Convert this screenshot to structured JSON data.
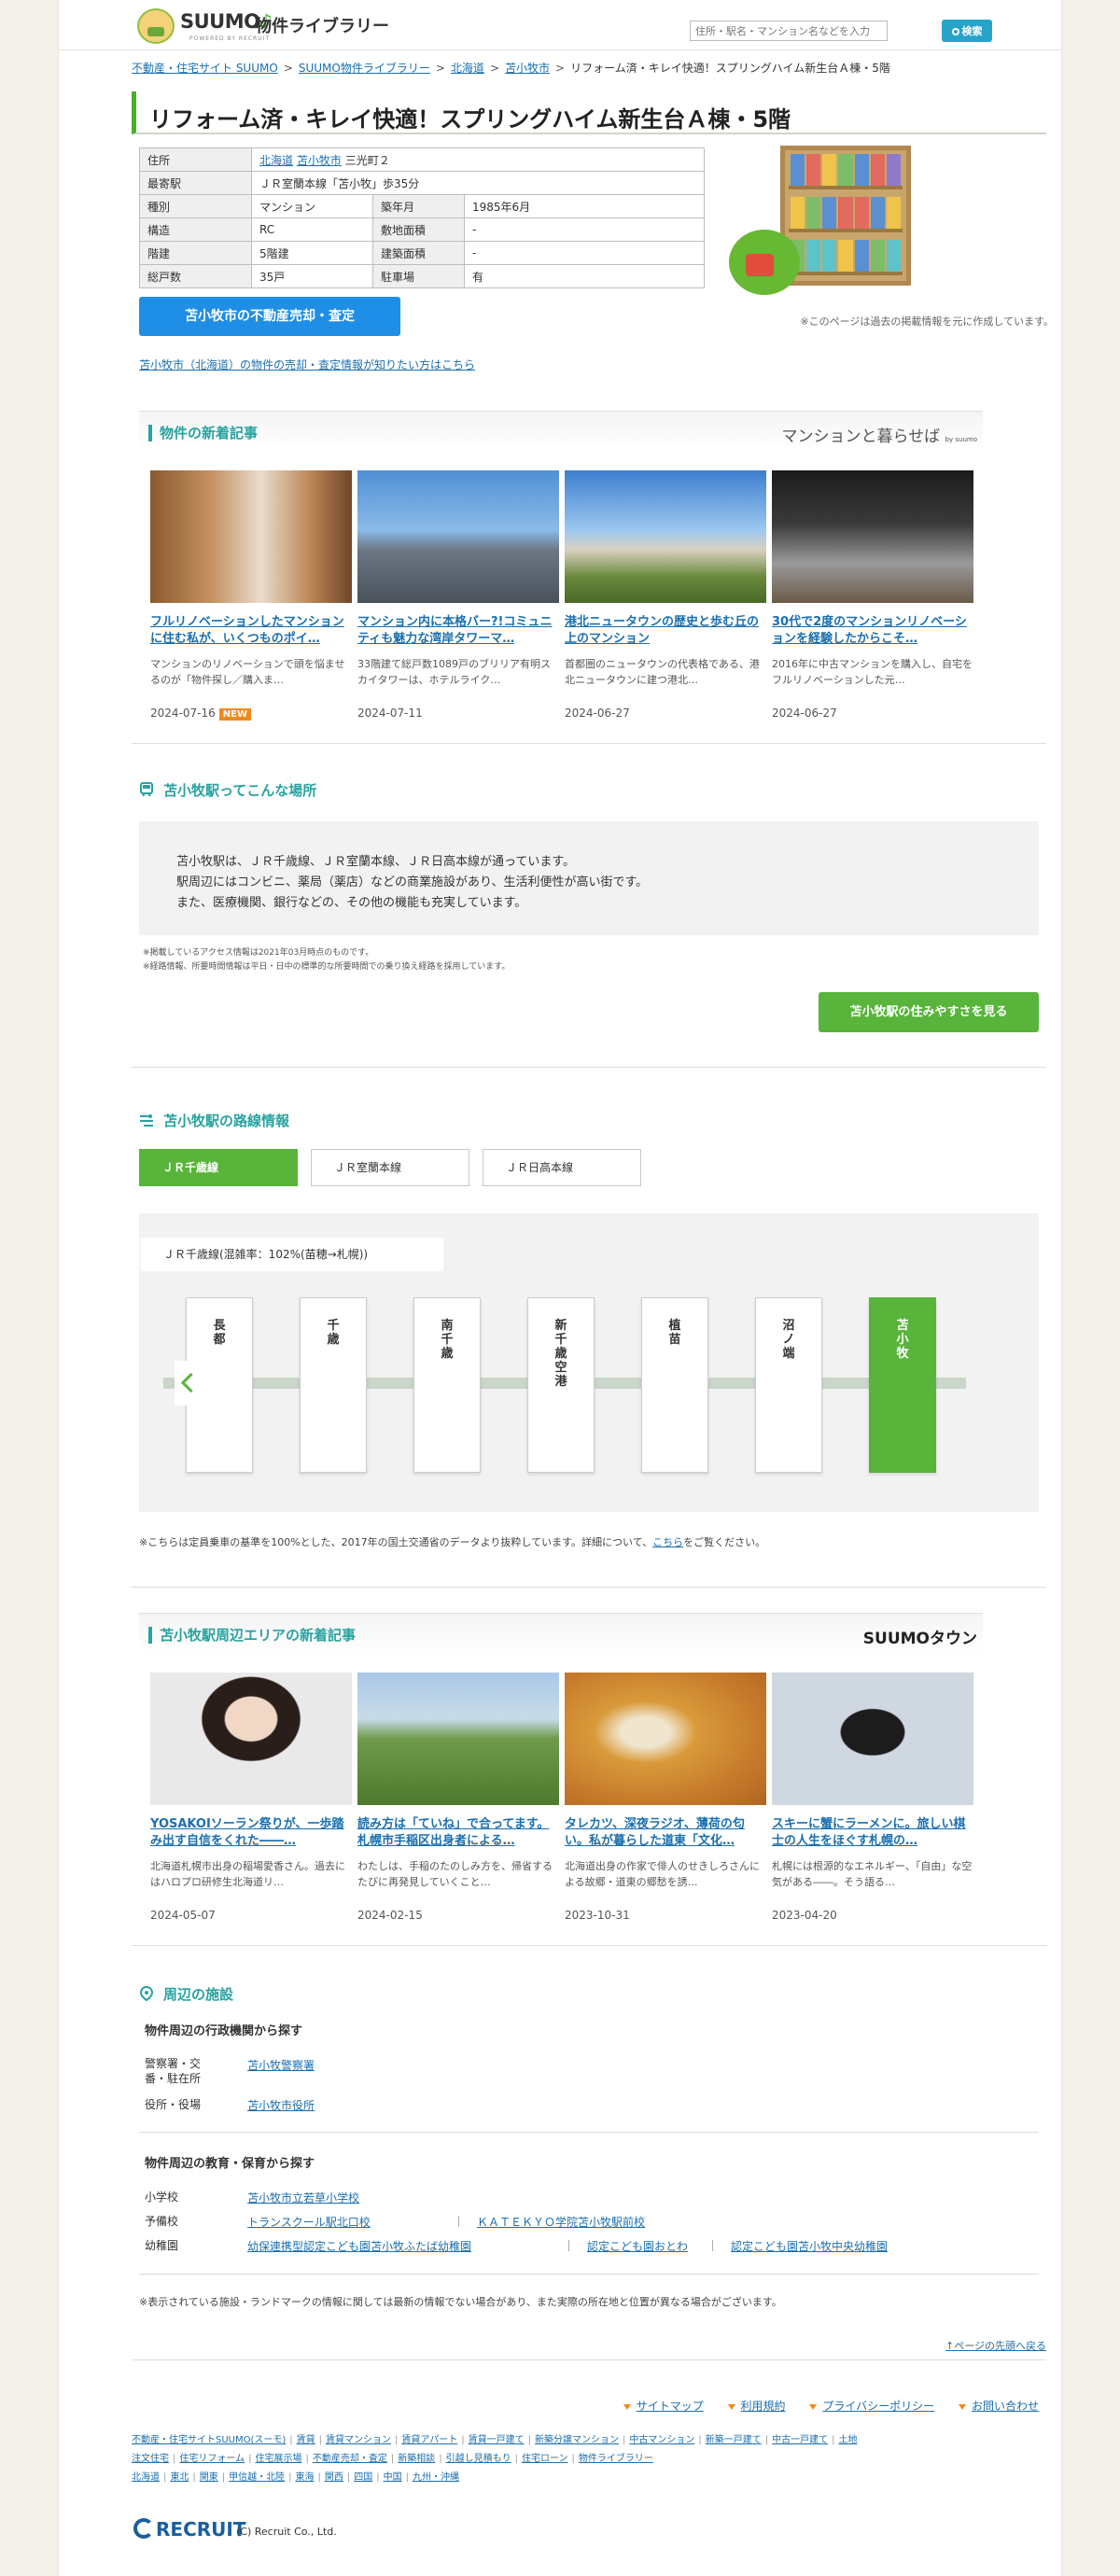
{
  "header": {
    "logo_main": "SUUMO",
    "logo_sub": "物件ライブラリー",
    "powered": "POWERED BY RECRUIT",
    "search_placeholder": "住所・駅名・マンション名などを入力",
    "search_button": "検索"
  },
  "breadcrumb": [
    "不動産・住宅サイト SUUMO",
    "SUUMO物件ライブラリー",
    "北海道",
    "苫小牧市",
    "リフォーム済・キレイ快適！スプリングハイム新生台Ａ棟・5階"
  ],
  "title": "リフォーム済・キレイ快適！スプリングハイム新生台Ａ棟・5階",
  "info": {
    "address_label": "住所",
    "address_links": [
      "北海道",
      "苫小牧市"
    ],
    "address_rest": "三光町２",
    "station_label": "最寄駅",
    "station_value": "ＪＲ室蘭本線「苫小牧」歩35分",
    "rows": [
      {
        "l1": "種別",
        "v1": "マンション",
        "l2": "築年月",
        "v2": "1985年6月"
      },
      {
        "l1": "構造",
        "v1": "RC",
        "l2": "敷地面積",
        "v2": "-"
      },
      {
        "l1": "階建",
        "v1": "5階建",
        "l2": "建築面積",
        "v2": "-"
      },
      {
        "l1": "総戸数",
        "v1": "35戸",
        "l2": "駐車場",
        "v2": "有"
      }
    ]
  },
  "sell_button": "苫小牧市の不動産売却・査定",
  "sell_link": "苫小牧市（北海道）の物件の売却・査定情報が知りたい方はこちら",
  "past_note": "※このページは過去の掲載情報を元に作成しています。",
  "new_articles": {
    "title": "物件の新着記事",
    "brand": "マンションと暮らせば",
    "brand_sub": "by suumo",
    "new_badge": "NEW",
    "items": [
      {
        "title": "フルリノベーションしたマンションに住む私が、いくつものポイ…",
        "desc": "マンションのリノベーションで頭を悩ませるのが「物件探し／購入ま…",
        "date": "2024-07-16",
        "is_new": true
      },
      {
        "title": "マンション内に本格バー?!コミュニティも魅力な湾岸タワーマ…",
        "desc": "33階建て総戸数1089戸のブリリア有明スカイタワーは、ホテルライク…",
        "date": "2024-07-11"
      },
      {
        "title": "港北ニュータウンの歴史と歩む丘の上のマンション",
        "desc": "首都圏のニュータウンの代表格である、港北ニュータウンに建つ港北…",
        "date": "2024-06-27"
      },
      {
        "title": "30代で2度のマンションリノベーションを経験したからこそ…",
        "desc": "2016年に中古マンションを購入し、自宅をフルリノベーションした元…",
        "date": "2024-06-27"
      }
    ]
  },
  "station": {
    "title": "苫小牧駅ってこんな場所",
    "lines": [
      "苫小牧駅は、ＪＲ千歳線、ＪＲ室蘭本線、ＪＲ日高本線が通っています。",
      "駅周辺にはコンビニ、薬局（薬店）などの商業施設があり、生活利便性が高い街です。",
      "また、医療機関、銀行などの、その他の機能も充実しています。"
    ],
    "notes": [
      "※掲載しているアクセス情報は2021年03月時点のものです。",
      "※経路情報、所要時間情報は平日・日中の標準的な所要時間での乗り換え経路を採用しています。"
    ],
    "button": "苫小牧駅の住みやすさを見る"
  },
  "route": {
    "title": "苫小牧駅の路線情報",
    "tabs": [
      "ＪＲ千歳線",
      "ＪＲ室蘭本線",
      "ＪＲ日高本線"
    ],
    "line_label": "ＪＲ千歳線(混雑率：102%(苗穂→札幌))",
    "stations": [
      "長都",
      "千歳",
      "南千歳",
      "新千歳空港",
      "植苗",
      "沼ノ端",
      "苫小牧"
    ],
    "note_before": "※こちらは定員乗車の基準を100%とした、2017年の国土交通省のデータより抜粋しています。詳細について、",
    "note_link": "こちら",
    "note_after": "をご覧ください。"
  },
  "area_articles": {
    "title": "苫小牧駅周辺エリアの新着記事",
    "brand": "SUUMOタウン",
    "items": [
      {
        "title": "YOSAKOIソーラン祭りが、一歩踏み出す自信をくれた――…",
        "desc": "北海道札幌市出身の稲場愛香さん。過去にはハロプロ研修生北海道リ…",
        "date": "2024-05-07"
      },
      {
        "title": "読み方は「ていね」で合ってます。札幌市手稲区出身者による…",
        "desc": "わたしは、手稲のたのしみ方を、帰省するたびに再発見していくこと…",
        "date": "2024-02-15"
      },
      {
        "title": "タレカツ、深夜ラジオ、薄荷の匂い。私が暮らした道東「文化…",
        "desc": "北海道出身の作家で俳人のせきしろさんによる故郷・道東の郷愁を誘…",
        "date": "2023-10-31"
      },
      {
        "title": "スキーに蟹にラーメンに。旅しい棋士の人生をほぐす札幌の…",
        "desc": "札幌には根源的なエネルギー、「自由」な空気がある――。そう語る…",
        "date": "2023-04-20"
      }
    ]
  },
  "facilities": {
    "title": "周辺の施設",
    "admin_title": "物件周辺の行政機関から探す",
    "police_label": "警察署・交番・駐在所",
    "police_value": "苫小牧警察署",
    "office_label": "役所・役場",
    "office_value": "苫小牧市役所",
    "edu_title": "物件周辺の教育・保育から探す",
    "elem_label": "小学校",
    "elem_value": "苫小牧市立若草小学校",
    "prep_label": "予備校",
    "prep_values": [
      "トランスクール駅北口校",
      "ＫＡＴＥＫＹＯ学院苫小牧駅前校"
    ],
    "kinder_label": "幼稚園",
    "kinder_values": [
      "幼保連携型認定こども園苫小牧ふたば幼稚園",
      "認定こども園おとわ",
      "認定こども園苫小牧中央幼稚園"
    ]
  },
  "foot_note": "※表示されている施設・ランドマークの情報に関しては最新の情報でない場合があり、また実際の所在地と位置が異なる場合がございます。",
  "page_top": "↑ページの先頭へ戻る",
  "footer_links": [
    "サイトマップ",
    "利用規約",
    "プライバシーポリシー",
    "お問い合わせ"
  ],
  "footer_row1": [
    "不動産・住宅サイトSUUMO(スーモ)",
    "賃貸",
    "賃貸マンション",
    "賃貸アパート",
    "賃貸一戸建て",
    "新築分譲マンション",
    "中古マンション",
    "新築一戸建て",
    "中古一戸建て",
    "土地"
  ],
  "footer_row2": [
    "注文住宅",
    "住宅リフォーム",
    "住宅展示場",
    "不動産売却・査定",
    "新築相談",
    "引越し見積もり",
    "住宅ローン",
    "物件ライブラリー"
  ],
  "footer_row3": [
    "北海道",
    "東北",
    "関東",
    "甲信越・北陸",
    "東海",
    "関西",
    "四国",
    "中国",
    "九州・沖縄"
  ],
  "recruit": "RECRUIT",
  "copyright": "(C) Recruit Co., Ltd."
}
